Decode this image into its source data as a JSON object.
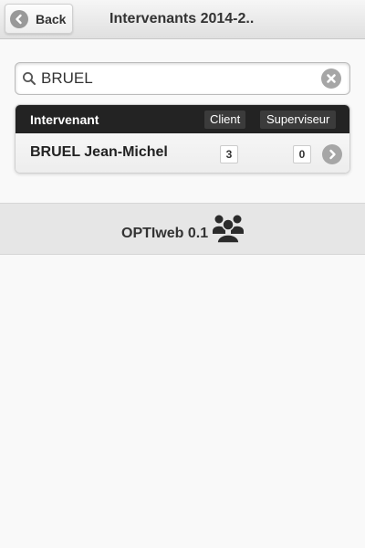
{
  "header": {
    "back_label": "Back",
    "title": "Intervenants 2014-2.."
  },
  "search": {
    "value": "BRUEL",
    "placeholder": ""
  },
  "list": {
    "columns": {
      "intervenant": "Intervenant",
      "client": "Client",
      "superviseur": "Superviseur"
    },
    "rows": [
      {
        "name": "BRUEL Jean-Michel",
        "client": "3",
        "superviseur": "0"
      }
    ]
  },
  "footer": {
    "label": "OPTIweb 0.1"
  },
  "icons": {
    "back": "arrow-left-circle-icon",
    "search": "magnifier-icon",
    "clear": "x-circle-icon",
    "row_action": "chevron-right-circle-icon",
    "footer": "users-group-icon"
  },
  "colors": {
    "list_header_bg": "#232323",
    "icon_gray": "#a6a6a6",
    "page_bg": "#f9f9f9"
  }
}
